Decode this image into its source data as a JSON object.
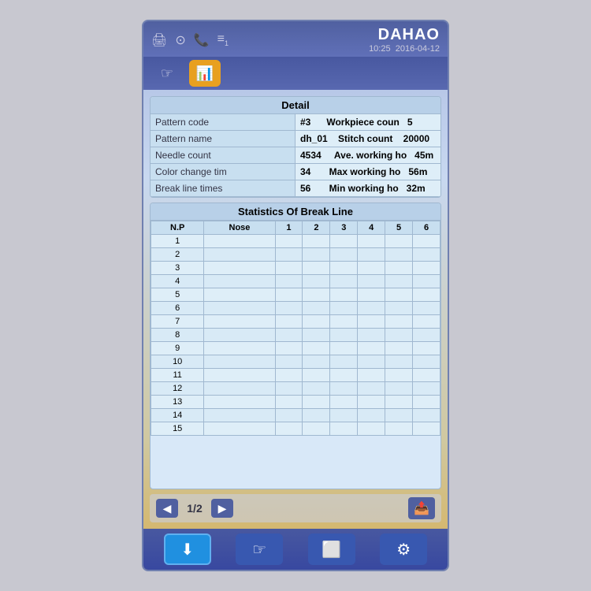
{
  "header": {
    "brand": "DAHAO",
    "time": "10:25",
    "date": "2016-04-12",
    "icons": [
      "🖨",
      "⊙",
      "📞",
      "≡1"
    ]
  },
  "detail": {
    "title": "Detail",
    "rows": [
      {
        "left_label": "Pattern code",
        "left_value": "#3",
        "right_label": "Workpiece coun",
        "right_value": "5"
      },
      {
        "left_label": "Pattern name",
        "left_value": "dh_01",
        "right_label": "Stitch count",
        "right_value": "20000"
      },
      {
        "left_label": "Needle count",
        "left_value": "4534",
        "right_label": "Ave. working ho",
        "right_value": "45m"
      },
      {
        "left_label": "Color change tim",
        "left_value": "34",
        "right_label": "Max working ho",
        "right_value": "56m"
      },
      {
        "left_label": "Break line times",
        "left_value": "56",
        "right_label": "Min working ho",
        "right_value": "32m"
      }
    ]
  },
  "statistics": {
    "title": "Statistics Of Break Line",
    "columns": [
      "N.P",
      "Nose",
      "1",
      "2",
      "3",
      "4",
      "5",
      "6"
    ],
    "rows": [
      1,
      2,
      3,
      4,
      5,
      6,
      7,
      8,
      9,
      10,
      11,
      12,
      13,
      14,
      15
    ]
  },
  "pagination": {
    "current": "1/2",
    "prev": "◀",
    "next": "▶"
  },
  "toolbar": {
    "hand_icon": "☞",
    "chart_icon": "📊"
  },
  "bottom_nav": {
    "items": [
      "needle",
      "hand",
      "rect",
      "pins"
    ]
  }
}
